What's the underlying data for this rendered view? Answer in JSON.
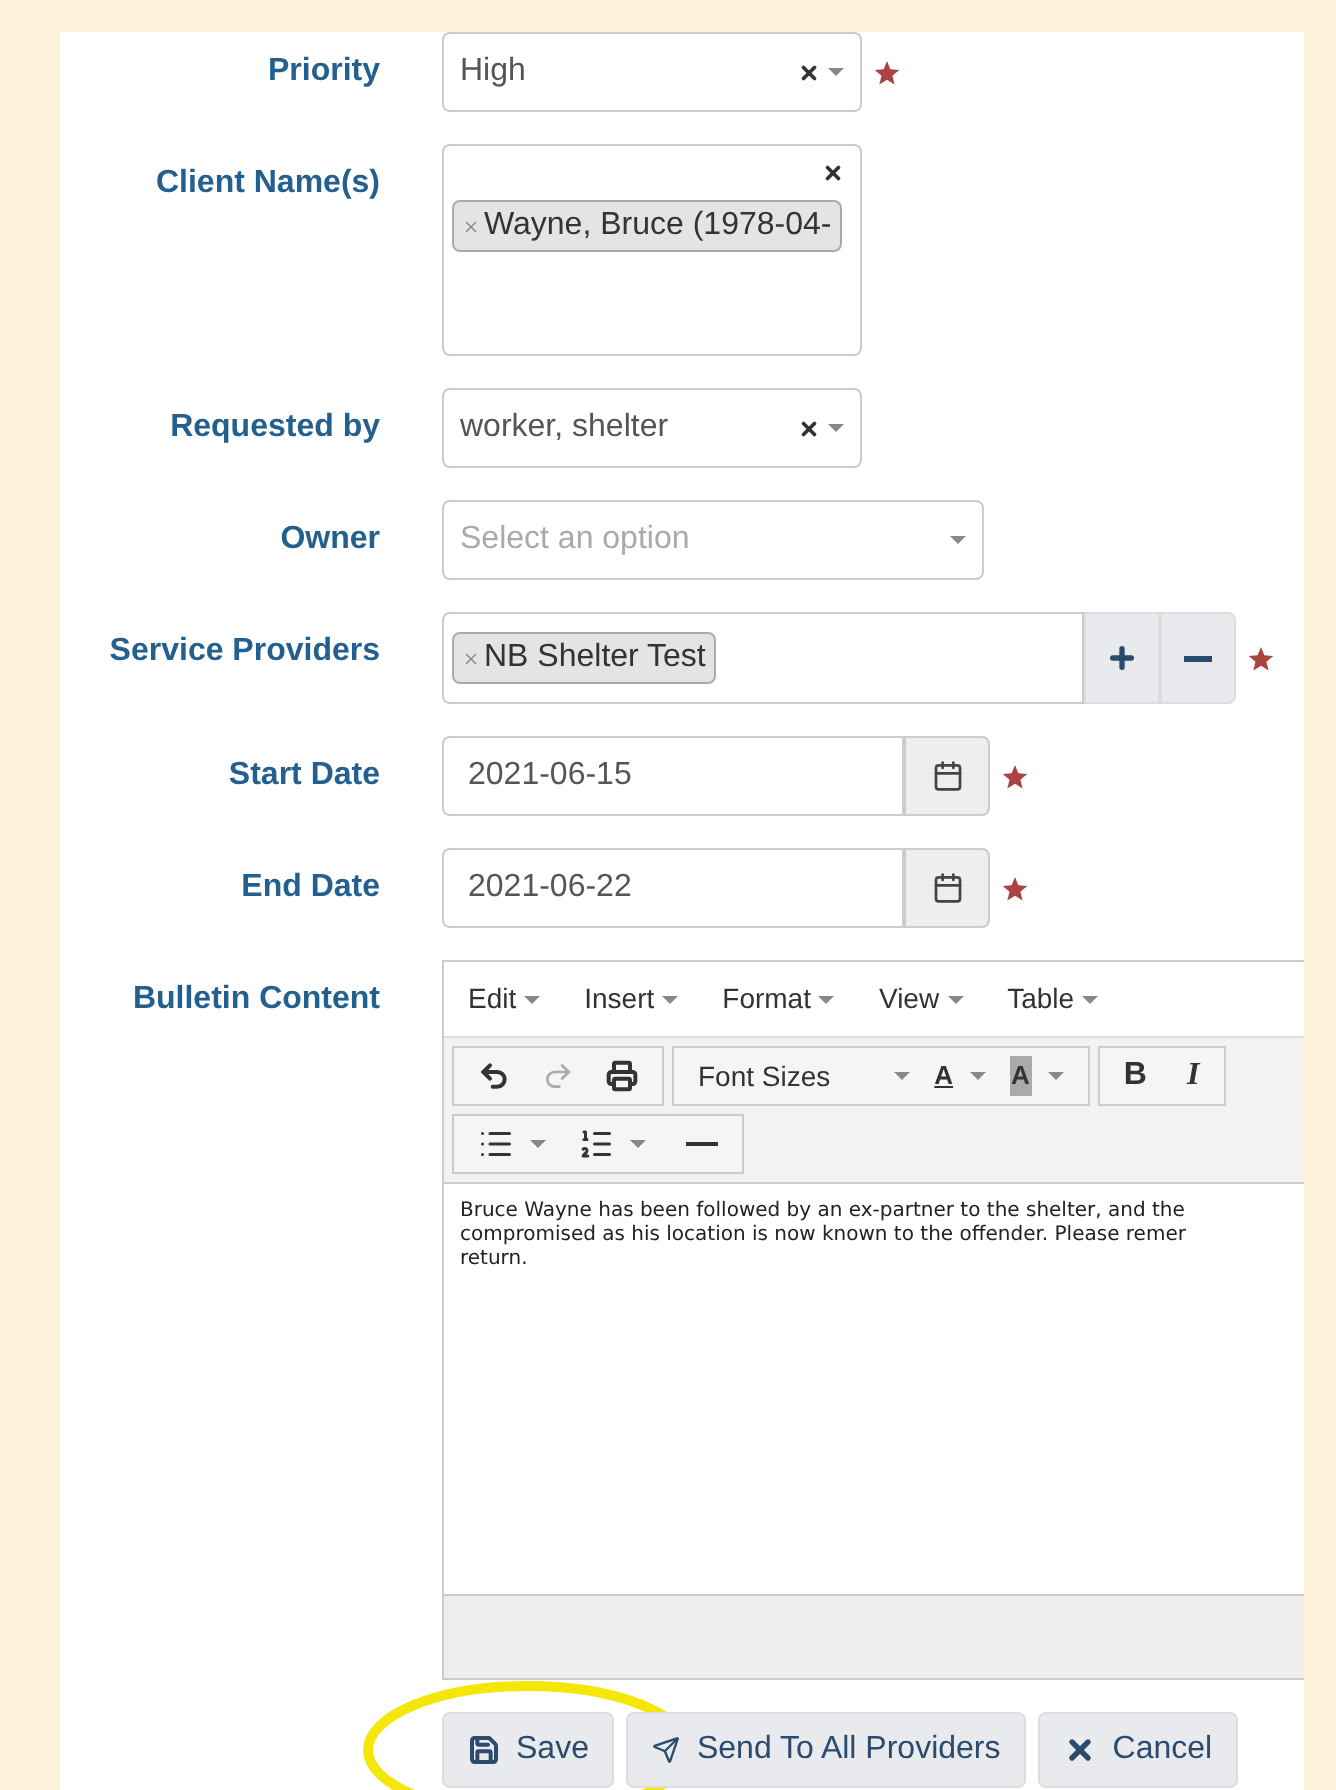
{
  "fields": [
    {
      "kind": "select",
      "label": "Priority",
      "value": "High",
      "clearable": true,
      "required": true
    },
    {
      "kind": "multiselect",
      "label": "Client Name(s)",
      "tags": [
        "Wayne, Bruce (1978-04-"
      ],
      "required": false
    },
    {
      "kind": "select",
      "label": "Requested by",
      "value": "worker, shelter",
      "clearable": true,
      "required": false
    },
    {
      "kind": "select",
      "label": "Owner",
      "placeholder": "Select an option",
      "clearable": false,
      "required": false
    },
    {
      "kind": "providers",
      "label": "Service Providers",
      "tags": [
        "NB Shelter Test"
      ],
      "required": true
    },
    {
      "kind": "date",
      "label": "Start Date",
      "value": "2021-06-15",
      "required": true
    },
    {
      "kind": "date",
      "label": "End Date",
      "value": "2021-06-22",
      "required": true
    },
    {
      "kind": "editor",
      "label": "Bulletin Content",
      "menu": [
        "Edit",
        "Insert",
        "Format",
        "View",
        "Table"
      ],
      "font_sizes": "Font Sizes",
      "text_color": "A",
      "bg_color": "A",
      "bold": "B",
      "italic": "I",
      "lines": [
        "Bruce Wayne has been followed by an ex-partner to the shelter, and the",
        "compromised as his location is now known to the offender. Please remer",
        "return."
      ]
    }
  ],
  "buttons": [
    {
      "kind": "save",
      "label": "Save",
      "highlighted": true
    },
    {
      "kind": "send",
      "label": "Send To All Providers",
      "highlighted": false
    },
    {
      "kind": "cancel",
      "label": "Cancel",
      "highlighted": false
    }
  ]
}
